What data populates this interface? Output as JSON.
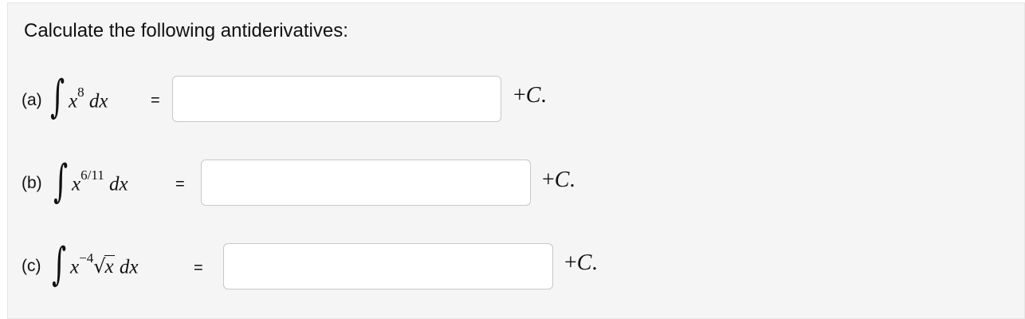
{
  "heading": "Calculate the following antiderivatives:",
  "parts": [
    {
      "label": "(a)",
      "integrand_base": "x",
      "exponent": "8",
      "differential": "dx",
      "equals": "=",
      "answer_value": "",
      "constant_prefix": "+",
      "constant": "C",
      "constant_suffix": "."
    },
    {
      "label": "(b)",
      "integrand_base": "x",
      "exponent": "6/11",
      "differential": "dx",
      "equals": "=",
      "answer_value": "",
      "constant_prefix": "+",
      "constant": "C",
      "constant_suffix": "."
    },
    {
      "label": "(c)",
      "integrand_base": "x",
      "exponent": "−4",
      "sqrt_symbol": "√",
      "sqrt_argument": "x",
      "differential": "dx",
      "equals": "=",
      "answer_value": "",
      "constant_prefix": "+",
      "constant": "C",
      "constant_suffix": "."
    }
  ],
  "integral_symbol": "∫"
}
